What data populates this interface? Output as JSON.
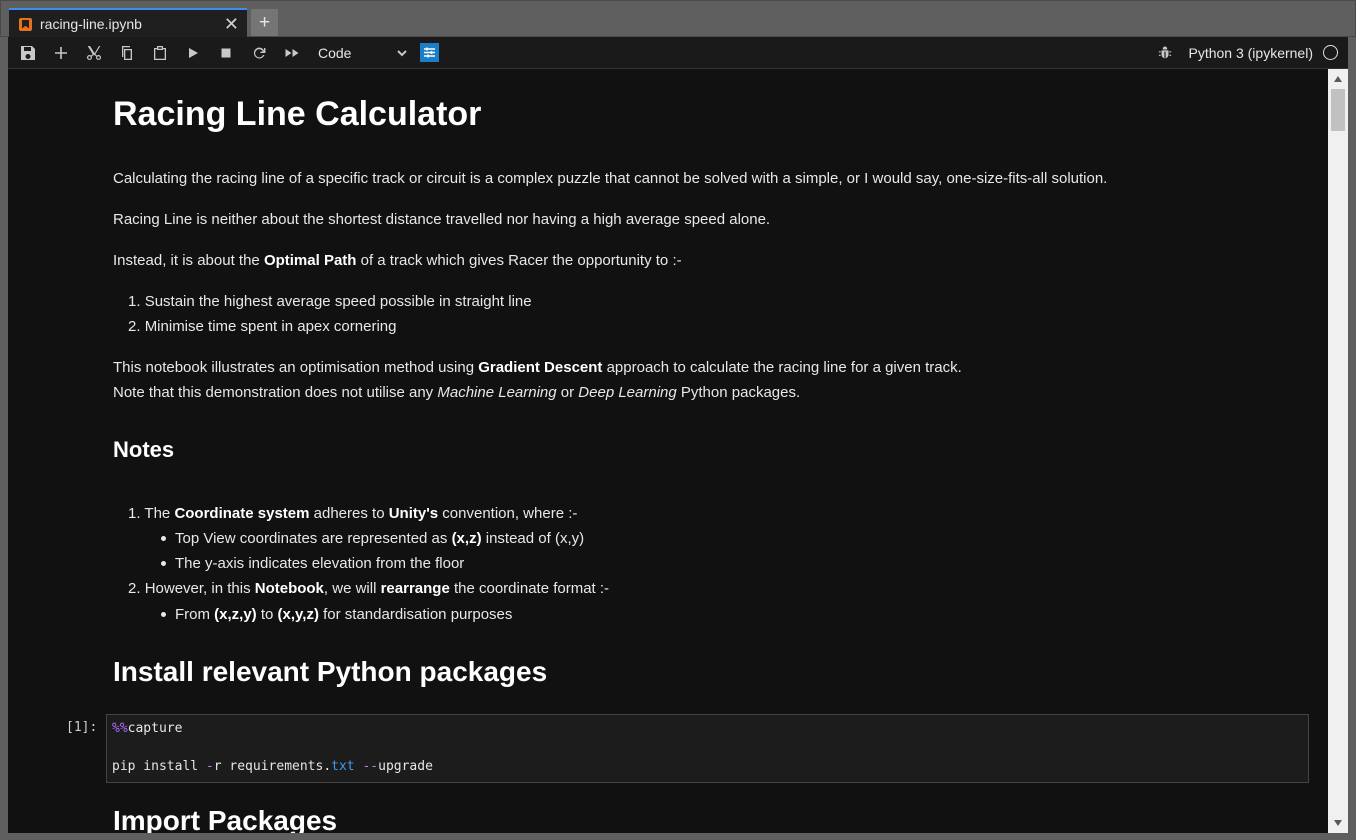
{
  "tab": {
    "title": "racing-line.ipynb",
    "close": "✕",
    "new_tab": "+"
  },
  "toolbar": {
    "buttons": [
      "save",
      "insert-cell",
      "cut",
      "copy",
      "paste",
      "run",
      "interrupt",
      "restart",
      "run-all"
    ],
    "cell_type": "Code",
    "kernel_name": "Python 3 (ipykernel)",
    "colors": {
      "accent": "#1c7fc5",
      "tab_active": "#3b8eea"
    }
  },
  "notebook": {
    "title": "Racing Line Calculator",
    "p1": "Calculating the racing line of a specific track or circuit is a complex puzzle that cannot be solved with a simple, or I would say, one-size-fits-all solution.",
    "p2": "Racing Line is neither about the shortest distance travelled nor having a high average speed alone.",
    "p3": {
      "pre": "Instead, it is about the ",
      "bold": "Optimal Path",
      "post": " of a track which gives Racer the opportunity to :-"
    },
    "list1": [
      {
        "num": "1.",
        "text": "Sustain the highest average speed possible in straight line"
      },
      {
        "num": "2.",
        "text": "Minimise time spent in apex cornering"
      }
    ],
    "p4": {
      "pre": "This notebook illustrates an optimisation method using ",
      "bold": "Gradient Descent",
      "post": " approach to calculate the racing line for a given track."
    },
    "p5": {
      "pre": "Note that this demonstration does not utilise any ",
      "em1": "Machine Learning",
      "mid": " or ",
      "em2": "Deep Learning",
      "post": " Python packages."
    },
    "notes_heading": "Notes",
    "notes": {
      "n1": {
        "num": "1.",
        "pre": "The ",
        "b1": "Coordinate system",
        "mid": " adheres to ",
        "b2": "Unity's",
        "post": " convention, where :-"
      },
      "n1a": {
        "pre": "Top View coordinates are represented as ",
        "b": "(x,z)",
        "post": " instead of (x,y)"
      },
      "n1b": "The y-axis indicates elevation from the floor",
      "n2": {
        "num": "2.",
        "pre": "However, in this ",
        "b1": "Notebook",
        "mid": ", we will ",
        "b2": "rearrange",
        "post": " the coordinate format :-"
      },
      "n2a": {
        "pre": "From ",
        "b1": "(x,z,y)",
        "mid": " to ",
        "b2": "(x,y,z)",
        "post": " for standardisation purposes"
      }
    },
    "install_heading": "Install relevant Python packages",
    "cell1": {
      "prompt": "[1]:",
      "line1_magic": "%%",
      "line1_rest": "capture",
      "line2": {
        "a": "pip install ",
        "op1": "-",
        "b": "r requirements",
        "dot": ".",
        "attr": "txt",
        "sp": " ",
        "op2": "--",
        "c": "upgrade"
      }
    },
    "import_heading": "Import Packages"
  }
}
